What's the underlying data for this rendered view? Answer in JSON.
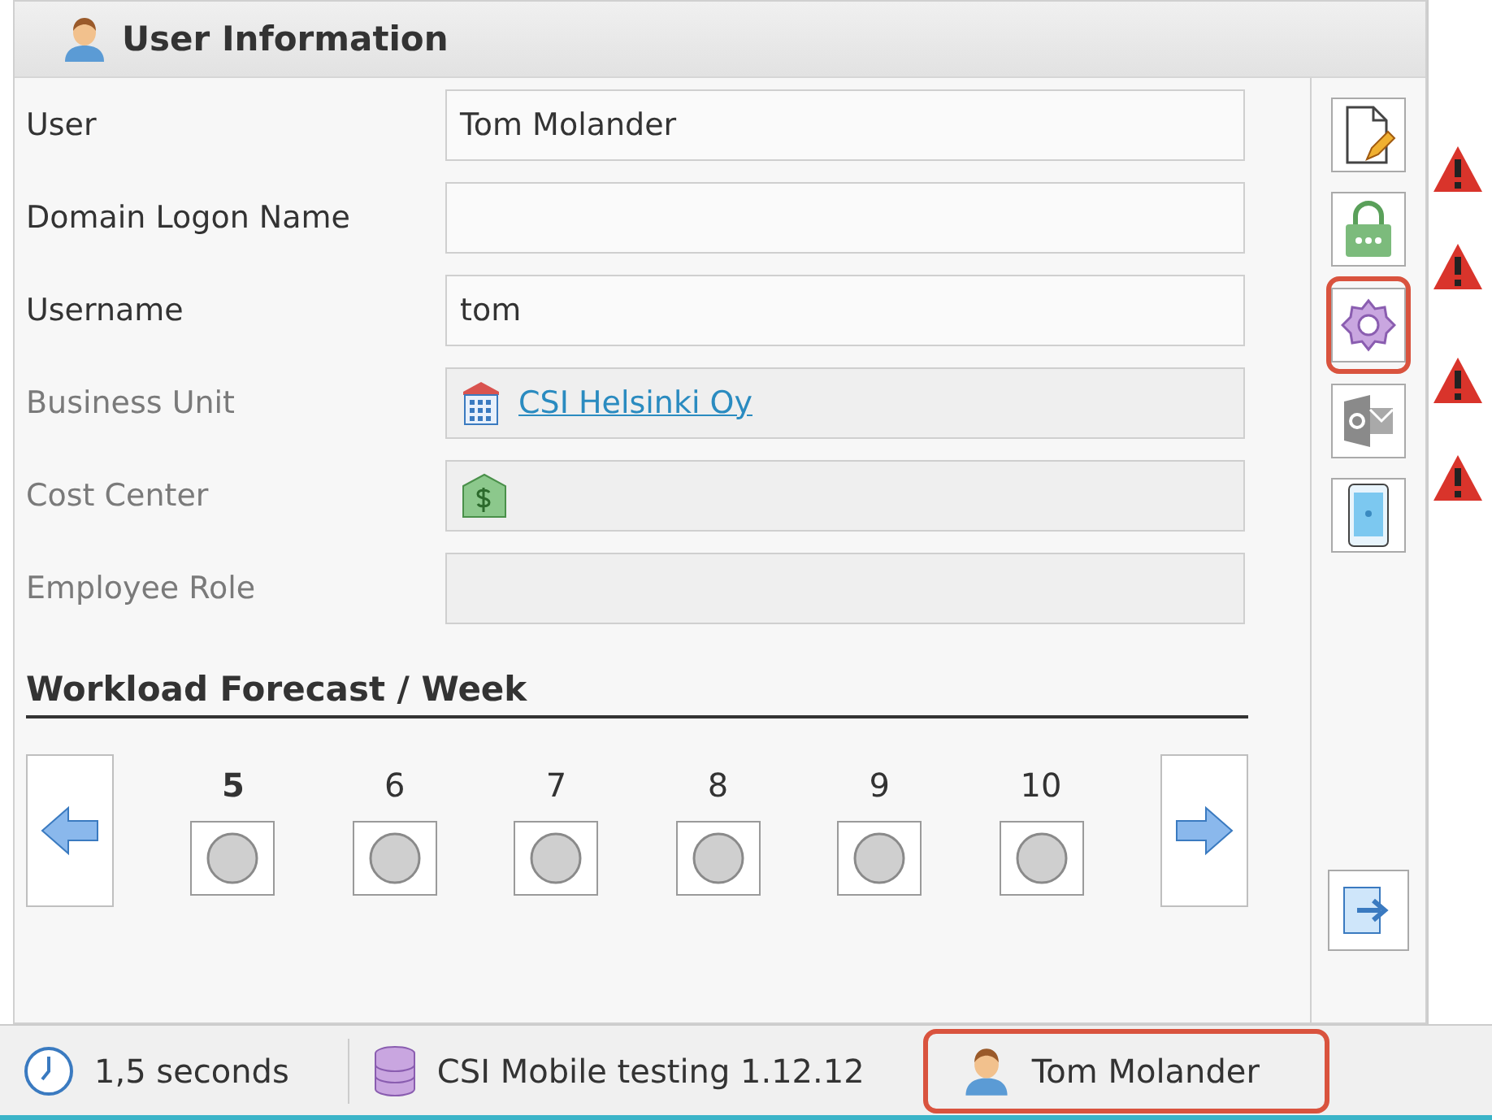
{
  "panel": {
    "title": "User Information"
  },
  "fields": [
    {
      "label": "User",
      "kind": "text",
      "value": "Tom Molander",
      "disabled": false
    },
    {
      "label": "Domain Logon Name",
      "kind": "text",
      "disabled": false
    },
    {
      "label": "Username",
      "kind": "text",
      "value": "tom",
      "disabled": false
    },
    {
      "label": "Business Unit",
      "kind": "link",
      "value": "CSI Helsinki Oy",
      "disabled": true
    },
    {
      "label": "Cost Center",
      "kind": "money",
      "disabled": true
    },
    {
      "label": "Employee Role",
      "kind": "text",
      "disabled": true
    }
  ],
  "workload": {
    "title": "Workload Forecast / Week",
    "weeks": [
      {
        "label": "5",
        "selected": true
      },
      {
        "label": "6",
        "selected": false
      },
      {
        "label": "7",
        "selected": false
      },
      {
        "label": "8",
        "selected": false
      },
      {
        "label": "9",
        "selected": false
      },
      {
        "label": "10",
        "selected": false
      }
    ]
  },
  "toolbar": [
    {
      "kind": "document",
      "highlighted": false
    },
    {
      "kind": "lock",
      "highlighted": false
    },
    {
      "kind": "gear",
      "highlighted": true
    },
    {
      "kind": "mail",
      "highlighted": false
    },
    {
      "kind": "phone",
      "highlighted": false
    }
  ],
  "status_bar": [
    {
      "kind": "clock",
      "text": "1,5 seconds",
      "highlighted": false
    },
    {
      "kind": "database",
      "text": "CSI Mobile testing 1.12.12",
      "highlighted": false
    },
    {
      "kind": "user",
      "text": "Tom Molander",
      "highlighted": true
    }
  ]
}
